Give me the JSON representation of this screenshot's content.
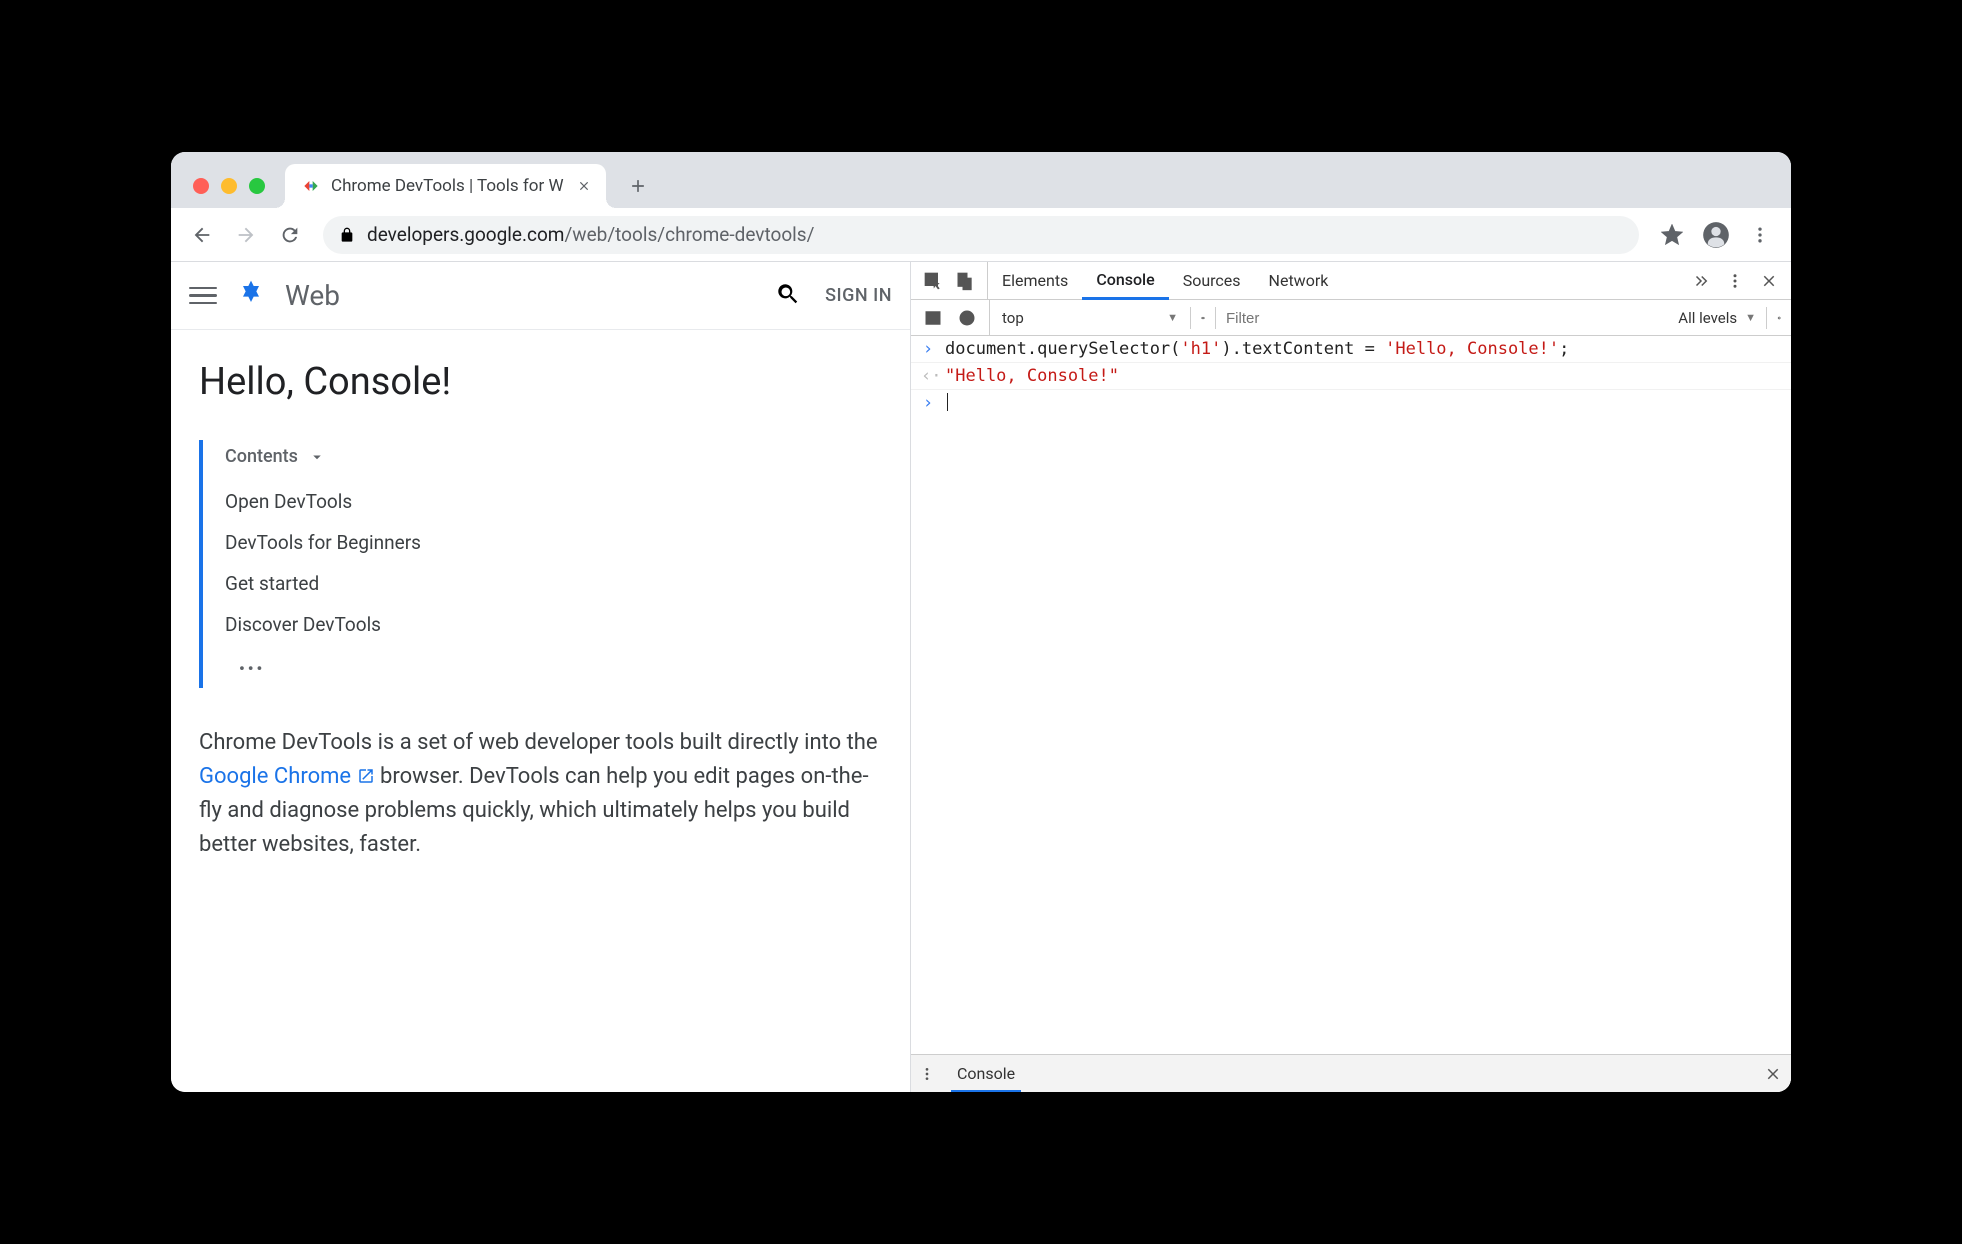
{
  "browser": {
    "tab_title": "Chrome DevTools  |  Tools for W",
    "url_host": "developers.google.com",
    "url_path": "/web/tools/chrome-devtools/"
  },
  "page": {
    "site_name": "Web",
    "signin": "SIGN IN",
    "h1": "Hello, Console!",
    "toc_label": "Contents",
    "toc_items": [
      "Open DevTools",
      "DevTools for Beginners",
      "Get started",
      "Discover DevTools"
    ],
    "body_pre": "Chrome DevTools is a set of web developer tools built directly into the ",
    "body_link": "Google Chrome",
    "body_post": " browser. DevTools can help you edit pages on-the-fly and diagnose problems quickly, which ultimately helps you build better websites, faster."
  },
  "devtools": {
    "tabs": [
      "Elements",
      "Console",
      "Sources",
      "Network"
    ],
    "active_tab": "Console",
    "context": "top",
    "filter_placeholder": "Filter",
    "levels": "All levels",
    "drawer_tab": "Console",
    "console": {
      "input_prefix": "document.querySelector(",
      "input_arg": "'h1'",
      "input_mid": ").textContent = ",
      "input_val": "'Hello, Console!'",
      "input_suffix": ";",
      "output": "\"Hello, Console!\""
    }
  }
}
